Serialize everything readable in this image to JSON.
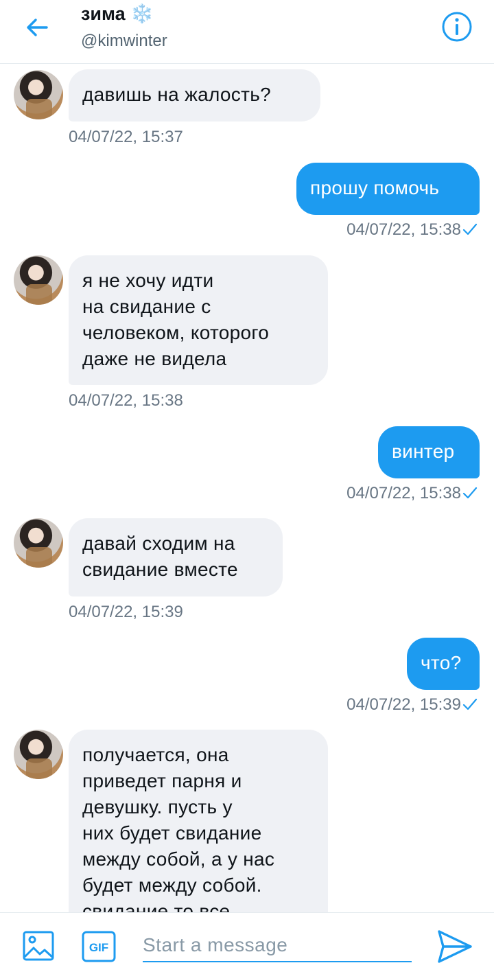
{
  "header": {
    "title": "зима ❄️",
    "handle": "@kimwinter",
    "back_icon": "arrow-left-icon",
    "info_icon": "info-circle-icon"
  },
  "colors": {
    "accent": "#1d9bf0",
    "incoming_bg": "#eff1f5",
    "timestamp": "#687684"
  },
  "messages": [
    {
      "from": "them",
      "text": "давишь на жалость?",
      "time": "04/07/22, 15:37"
    },
    {
      "from": "me",
      "text": "прошу помочь",
      "time": "04/07/22, 15:38",
      "status": "sent"
    },
    {
      "from": "them",
      "text": "я не хочу идти\nна свидание с\nчеловеком, которого\nдаже не видела",
      "time": "04/07/22, 15:38"
    },
    {
      "from": "me",
      "text": "винтер",
      "time": "04/07/22, 15:38",
      "status": "sent"
    },
    {
      "from": "them",
      "text": "давай сходим на\nсвидание вместе",
      "time": "04/07/22, 15:39"
    },
    {
      "from": "me",
      "text": "что?",
      "time": "04/07/22, 15:39",
      "status": "sent"
    },
    {
      "from": "them",
      "text": "получается, она\nприведет парня и\nдевушку. пусть у\nних будет свидание\nмежду собой, а у нас\nбудет между собой.\nсвидание то все",
      "time": ""
    }
  ],
  "composer": {
    "placeholder": "Start a message",
    "image_icon": "image-icon",
    "gif_icon": "gif-icon",
    "gif_label": "GIF",
    "send_icon": "send-icon"
  }
}
